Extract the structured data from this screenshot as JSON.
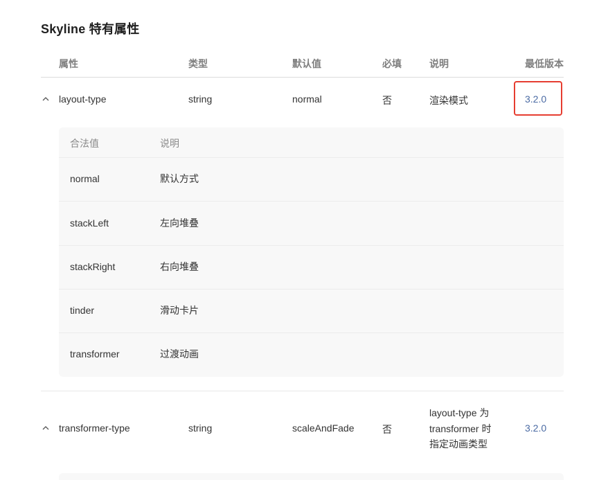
{
  "section": {
    "title": "Skyline 特有属性"
  },
  "columns": {
    "attr": "属性",
    "type": "类型",
    "default": "默认值",
    "required": "必填",
    "desc": "说明",
    "version": "最低版本"
  },
  "rows": [
    {
      "name": "layout-type",
      "type": "string",
      "default": "normal",
      "required": "否",
      "desc": "渲染模式",
      "version": "3.2.0",
      "expanded": true,
      "values_header": {
        "value": "合法值",
        "desc": "说明"
      },
      "values": [
        {
          "value": "normal",
          "desc": "默认方式"
        },
        {
          "value": "stackLeft",
          "desc": "左向堆叠"
        },
        {
          "value": "stackRight",
          "desc": "右向堆叠"
        },
        {
          "value": "tinder",
          "desc": "滑动卡片"
        },
        {
          "value": "transformer",
          "desc": "过渡动画"
        }
      ]
    },
    {
      "name": "transformer-type",
      "type": "string",
      "default": "scaleAndFade",
      "required": "否",
      "desc_lines": [
        "layout-type 为",
        "transformer 时",
        "指定动画类型"
      ],
      "version": "3.2.0",
      "expanded": true
    }
  ],
  "colors": {
    "link": "#4a6aa3",
    "highlight_border": "#e63d30"
  }
}
